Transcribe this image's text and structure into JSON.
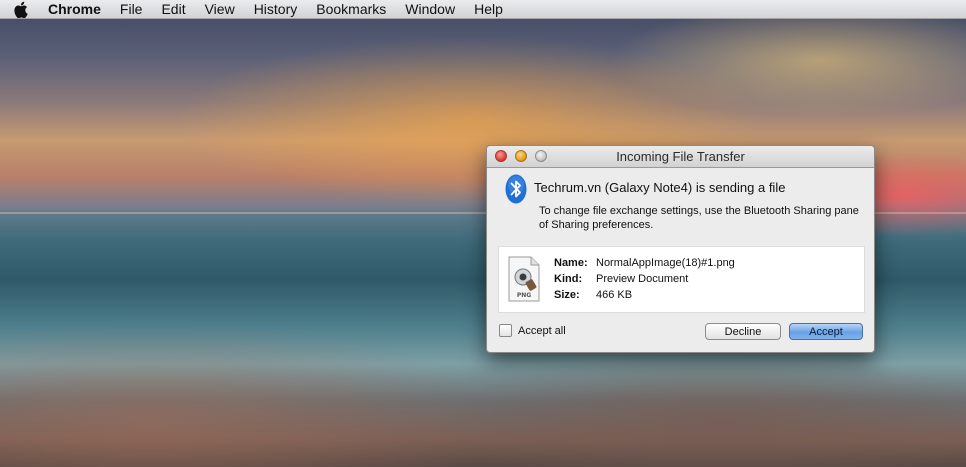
{
  "menubar": {
    "apple_icon": "apple-icon",
    "app_name": "Chrome",
    "items": [
      "File",
      "Edit",
      "View",
      "History",
      "Bookmarks",
      "Window",
      "Help"
    ]
  },
  "dialog": {
    "title": "Incoming File Transfer",
    "icon": "bluetooth-icon",
    "headline": "Techrum.vn (Galaxy Note4) is sending a file",
    "description": "To change file exchange settings, use the Bluetooth Sharing pane of Sharing preferences.",
    "file": {
      "icon_label": "PNG",
      "name_label": "Name:",
      "name_value": "NormalAppImage(18)#1.png",
      "kind_label": "Kind:",
      "kind_value": "Preview Document",
      "size_label": "Size:",
      "size_value": "466 KB"
    },
    "accept_all_label": "Accept all",
    "accept_all_checked": false,
    "decline_label": "Decline",
    "accept_label": "Accept"
  },
  "colors": {
    "accept_button": "#6aa2e6",
    "bluetooth_blue": "#1f6fd6"
  }
}
